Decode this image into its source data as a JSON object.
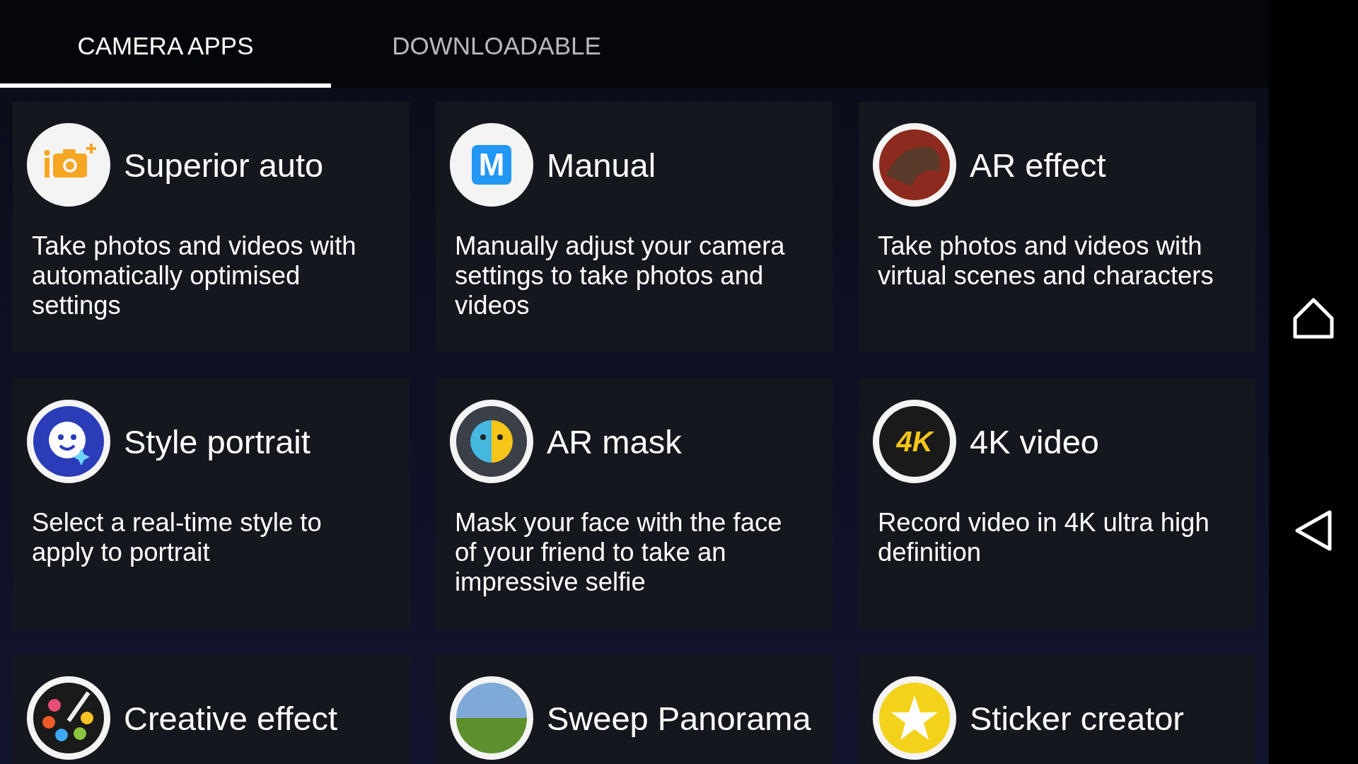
{
  "tabs": [
    {
      "label": "CAMERA APPS",
      "selected": true
    },
    {
      "label": "DOWNLOADABLE",
      "selected": false
    }
  ],
  "apps": [
    {
      "title": "Superior auto",
      "description": "Take photos and videos with automatically optimised settings",
      "kind": "camera"
    },
    {
      "title": "Manual",
      "description": "Manually adjust your camera settings to take photos and videos",
      "kind": "letter",
      "icon_text": "M"
    },
    {
      "title": "AR effect",
      "description": "Take photos and videos with virtual scenes and characters",
      "kind": "photo"
    },
    {
      "title": "Style portrait",
      "description": "Select a real-time style to apply to portrait",
      "kind": "face"
    },
    {
      "title": "AR mask",
      "description": "Mask your face with the face of your friend to take an impressive selfie",
      "kind": "mask"
    },
    {
      "title": "4K video",
      "description": "Record video in 4K ultra high definition",
      "kind": "dark-text",
      "icon_text": "4K"
    },
    {
      "title": "Creative effect",
      "kind": "palette"
    },
    {
      "title": "Sweep Panorama",
      "kind": "landscape"
    },
    {
      "title": "Sticker creator",
      "kind": "star"
    }
  ]
}
